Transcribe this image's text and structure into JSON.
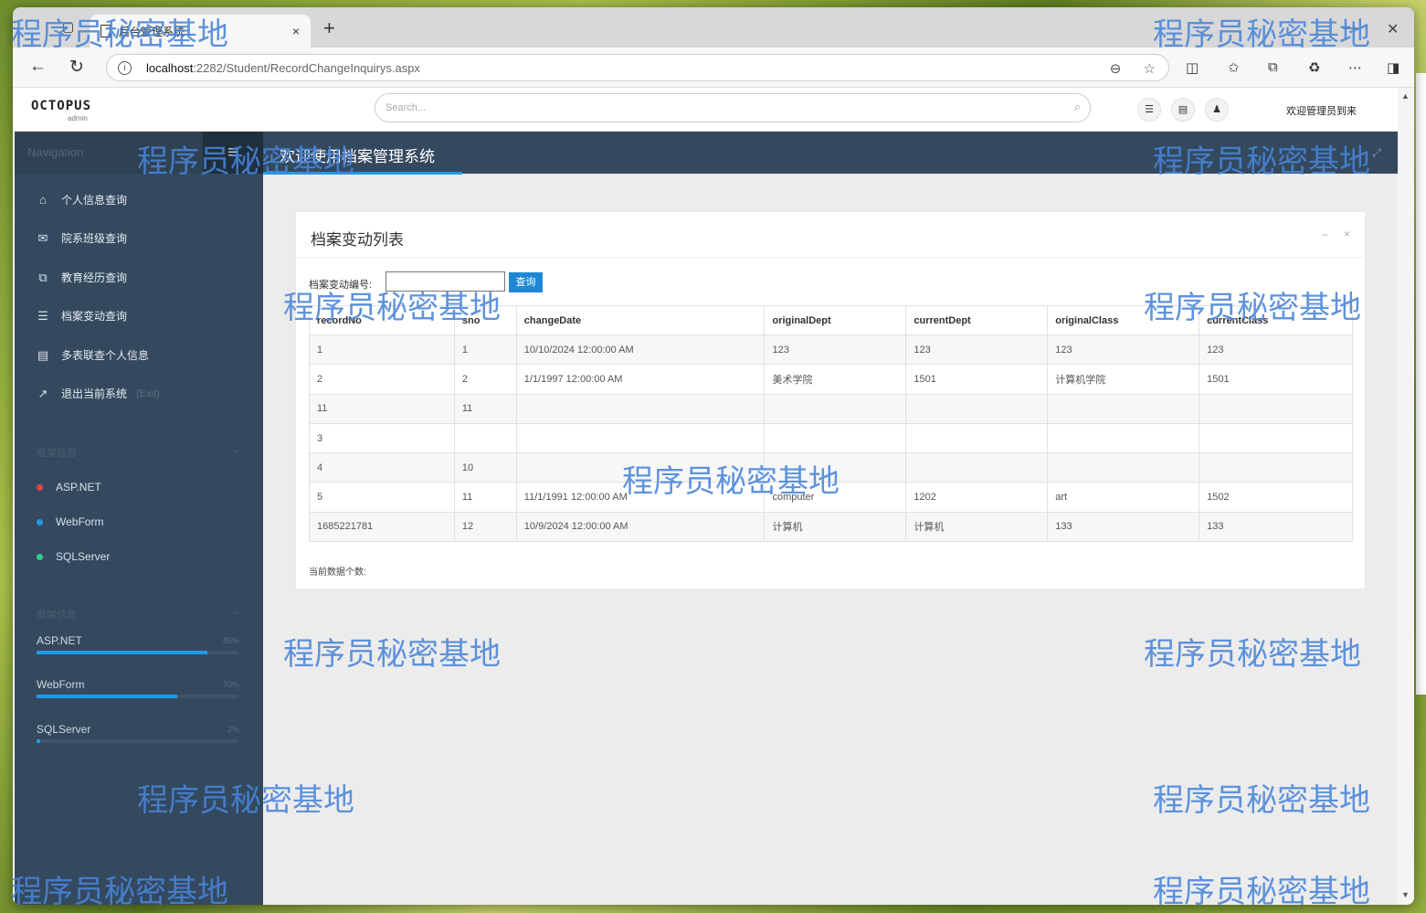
{
  "browser": {
    "tab_title": "后台管理系统",
    "new_tab": "+",
    "close_tab": "×",
    "url_host": "localhost",
    "url_path": ":2282/Student/RecordChangeInquirys.aspx"
  },
  "header": {
    "logo": "OCTOPUS",
    "logo_sub": "admin",
    "search_placeholder": "Search...",
    "welcome": "欢迎管理员到来"
  },
  "sidebar": {
    "nav_label": "Navigation",
    "menu": [
      {
        "label": "个人信息查询",
        "icon": "home-icon"
      },
      {
        "label": "院系班级查询",
        "icon": "envelope-icon"
      },
      {
        "label": "教育经历查询",
        "icon": "files-icon"
      },
      {
        "label": "档案变动查询",
        "icon": "list-icon"
      },
      {
        "label": "多表联查个人信息",
        "icon": "table-icon"
      },
      {
        "label": "退出当前系统",
        "icon": "external-link-icon",
        "hint": "(Exit)"
      }
    ],
    "section1_title": "框架信息",
    "tags": [
      {
        "label": "ASP.NET",
        "color": "#e8444a"
      },
      {
        "label": "WebForm",
        "color": "#1e9be8"
      },
      {
        "label": "SQLServer",
        "color": "#2ecc8f"
      }
    ],
    "section2_title": "框架信息",
    "progress": [
      {
        "label": "ASP.NET",
        "pct": "85%",
        "value": 0.85
      },
      {
        "label": "WebForm",
        "pct": "70%",
        "value": 0.7
      },
      {
        "label": "SQLServer",
        "pct": "2%",
        "value": 0.02
      }
    ]
  },
  "main": {
    "welcome": "欢迎使用档案管理系统",
    "panel_title": "档案变动列表",
    "filter_label": "档案变动编号:",
    "filter_value": "",
    "query_button": "查询",
    "count_label": "当前数据个数:",
    "table": {
      "headers": [
        "recordNo",
        "sno",
        "changeDate",
        "originalDept",
        "currentDept",
        "originalClass",
        "currentClass"
      ],
      "rows": [
        [
          "1",
          "1",
          "10/10/2024 12:00:00 AM",
          "123",
          "123",
          "123",
          "123"
        ],
        [
          "2",
          "2",
          "1/1/1997 12:00:00 AM",
          "美术学院",
          "1501",
          "计算机学院",
          "1501"
        ],
        [
          "11",
          "11",
          "",
          "",
          "",
          "",
          ""
        ],
        [
          "3",
          "",
          "",
          "",
          "",
          "",
          ""
        ],
        [
          "4",
          "10",
          "",
          "",
          "",
          "",
          ""
        ],
        [
          "5",
          "11",
          "11/1/1991 12:00:00 AM",
          "computer",
          "1202",
          "art",
          "1502"
        ],
        [
          "1685221781",
          "12",
          "10/9/2024 12:00:00 AM",
          "计算机",
          "计算机",
          "133",
          "133"
        ]
      ]
    }
  },
  "watermark_text": "程序员秘密基地"
}
